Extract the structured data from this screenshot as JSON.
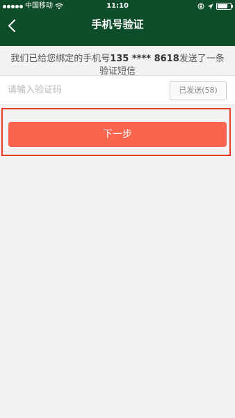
{
  "status_bar": {
    "carrier": "中国移动",
    "time": "11:10"
  },
  "header": {
    "back_icon": "chevron-left-icon",
    "title": "手机号验证"
  },
  "sms_notice": {
    "prefix": "我们已给您绑定的手机号",
    "phone": "135 **** 8618",
    "suffix": "发送了一条验证短信"
  },
  "code_field": {
    "placeholder": "请输入验证码",
    "value": ""
  },
  "resend_button": {
    "label": "已发送(58)"
  },
  "next_button": {
    "label": "下一步"
  },
  "colors": {
    "header_bg": "#0e4d2a",
    "page_bg": "#f2f2f2",
    "next_button_bg": "#fb6550",
    "highlight_border": "#e83a25"
  }
}
